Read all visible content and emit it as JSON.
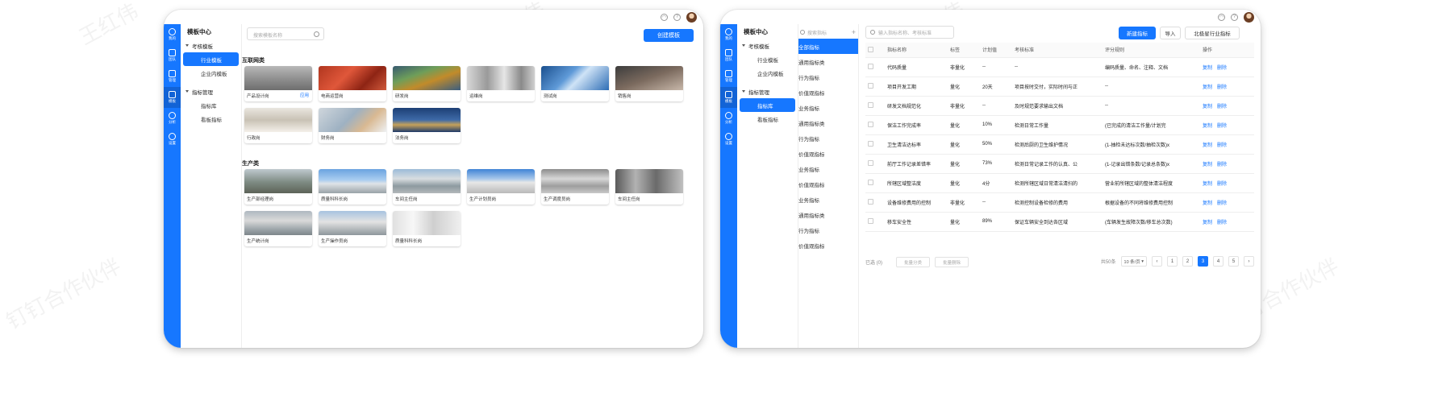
{
  "watermark": "钉钉合作伙伴",
  "watermark_partial": "王红伟",
  "rail_items": [
    {
      "label": "我的"
    },
    {
      "label": "团队"
    },
    {
      "label": "管理"
    },
    {
      "label": "模板"
    },
    {
      "label": "分析"
    },
    {
      "label": "设置"
    }
  ],
  "nav": {
    "title": "模板中心",
    "group1": "考核模板",
    "group1_items": [
      "行业模板",
      "企业内模板"
    ],
    "group2": "指标管理",
    "group2_items": [
      "指标库",
      "看板指标"
    ]
  },
  "left": {
    "search_placeholder": "搜索模板名称",
    "create_button": "创建模板",
    "sections": [
      {
        "title": "互联网类",
        "cards": [
          {
            "label": "产品设计岗",
            "action": "应用"
          },
          {
            "label": "电商运营岗"
          },
          {
            "label": "研发岗"
          },
          {
            "label": "运维岗"
          },
          {
            "label": "测试岗"
          },
          {
            "label": "销售岗"
          },
          {
            "label": "行政岗"
          },
          {
            "label": "财务岗"
          },
          {
            "label": "法务岗"
          }
        ]
      },
      {
        "title": "生产类",
        "cards": [
          {
            "label": "生产部经理岗"
          },
          {
            "label": "质量科科长岗"
          },
          {
            "label": "车间主任岗"
          },
          {
            "label": "生产计划员岗"
          },
          {
            "label": "生产调度员岗"
          },
          {
            "label": "车间主任岗"
          },
          {
            "label": "生产统计岗"
          },
          {
            "label": "生产操作员岗"
          },
          {
            "label": "质量科科长岗"
          }
        ]
      }
    ]
  },
  "right": {
    "sub_search_placeholder": "搜索指标",
    "sub_items": [
      "全部指标",
      "通用指标类",
      "行为指标",
      "价值观指标",
      "业务指标",
      "通用指标类",
      "行为指标",
      "价值观指标",
      "业务指标",
      "价值观指标",
      "业务指标",
      "通用指标类",
      "行为指标",
      "价值观指标"
    ],
    "search_placeholder": "输入指标名称、考核标准",
    "buttons": {
      "new": "新建指标",
      "import": "导入",
      "industry": "北极星行业指标"
    },
    "columns": [
      "指标名称",
      "标签",
      "计划值",
      "考核标准",
      "评分规则",
      "操作"
    ],
    "row_actions": {
      "copy": "复制",
      "delete": "删除"
    },
    "rows": [
      {
        "name": "代码质量",
        "tag": "非量化",
        "plan": "--",
        "standard": "--",
        "rule": "编码质量、命名、注释、文档"
      },
      {
        "name": "项目开发工期",
        "tag": "量化",
        "plan": "20天",
        "standard": "项目按时交付，实际时间与正",
        "rule": "--"
      },
      {
        "name": "研发文档规范化",
        "tag": "非量化",
        "plan": "--",
        "standard": "及时规范要求输出文档",
        "rule": "--"
      },
      {
        "name": "保洁工作完成率",
        "tag": "量化",
        "plan": "10%",
        "standard": "检测日常工作量",
        "rule": "(已完成的清洁工作量/计划完"
      },
      {
        "name": "卫生清洁达标率",
        "tag": "量化",
        "plan": "50%",
        "standard": "检测后厨的卫生维护情况",
        "rule": "(1-抽检未达标次数/抽检次数)x"
      },
      {
        "name": "前厅工作记录差错率",
        "tag": "量化",
        "plan": "73%",
        "standard": "检测日常记录工作的认真、公",
        "rule": "(1-记录出错条数/记录总条数)x"
      },
      {
        "name": "所辖区域整洁度",
        "tag": "量化",
        "plan": "4分",
        "standard": "检测所辖区域日常清洁清扫的",
        "rule": "营业前所辖区域的整体清洁程度"
      },
      {
        "name": "设备维修费用的控制",
        "tag": "非量化",
        "plan": "--",
        "standard": "检测控制设备检修的费用",
        "rule": "根据设备的不同将维修费用控制"
      },
      {
        "name": "移车安全性",
        "tag": "量化",
        "plan": "89%",
        "standard": "保证车辆安全到达各区域",
        "rule": "(车辆发生故障次数/移车总次数)"
      }
    ],
    "footer": {
      "selected": "已选 (0)",
      "batch_relate": "批量分类",
      "batch_delete": "批量删除",
      "total": "共50条",
      "page_size": "10 条/页",
      "pages": [
        "1",
        "2",
        "3",
        "4",
        "5"
      ],
      "current_page": "3"
    }
  },
  "colors": {
    "primary": "#1677ff",
    "rail": "#1677ff"
  }
}
